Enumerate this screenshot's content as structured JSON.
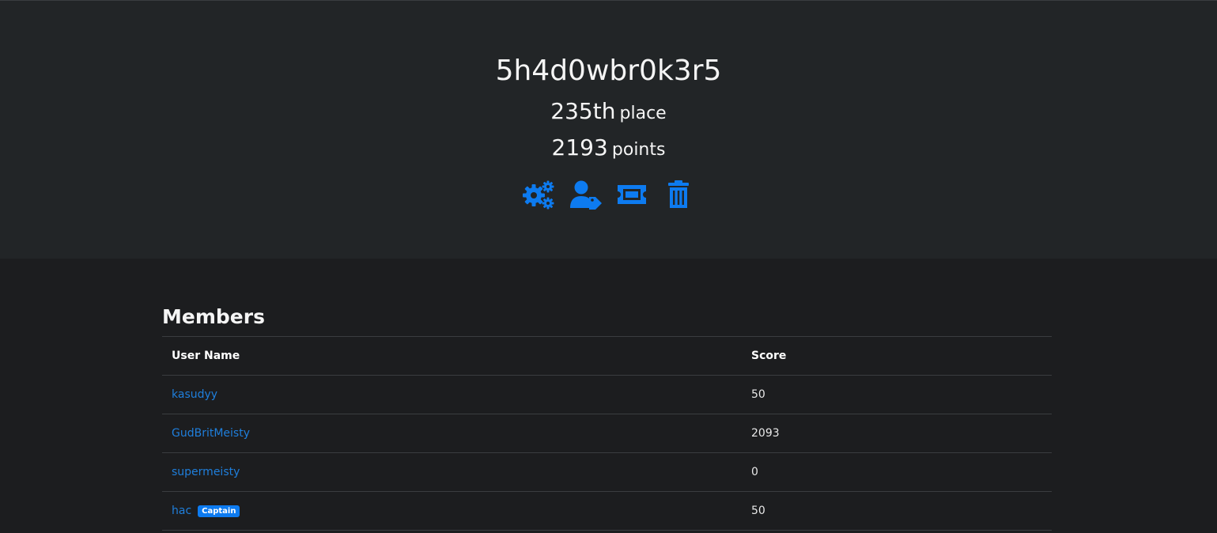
{
  "team": {
    "name": "5h4d0wbr0k3r5",
    "place_number": "235th",
    "place_label": "place",
    "points_number": "2193",
    "points_label": "points"
  },
  "actions": [
    {
      "icon": "gears-icon"
    },
    {
      "icon": "user-tag-icon"
    },
    {
      "icon": "ticket-icon"
    },
    {
      "icon": "trash-icon"
    }
  ],
  "members": {
    "title": "Members",
    "columns": [
      "User Name",
      "Score"
    ],
    "rows": [
      {
        "name": "kasudyy",
        "score": "50"
      },
      {
        "name": "GudBritMeisty",
        "score": "2093"
      },
      {
        "name": "supermeisty",
        "score": "0"
      },
      {
        "name": "hac",
        "badge": "Captain",
        "score": "50"
      }
    ]
  },
  "colors": {
    "accent": "#0d7bf0",
    "header_bg": "#222527",
    "page_bg": "#1c1d1f"
  }
}
